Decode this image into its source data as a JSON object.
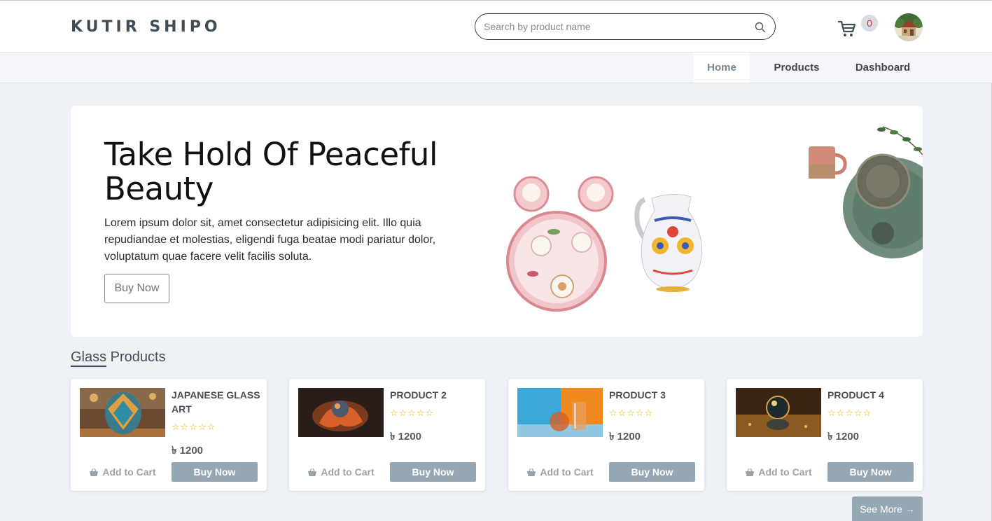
{
  "header": {
    "brand": "KUTIR SHIPO",
    "search_placeholder": "Search by product name",
    "cart_count": "0"
  },
  "nav": {
    "items": [
      {
        "label": "Home"
      },
      {
        "label": "Products"
      },
      {
        "label": "Dashboard"
      }
    ]
  },
  "hero": {
    "title": "Take Hold Of Peaceful Beauty",
    "text": "Lorem ipsum dolor sit, amet consectetur adipisicing elit. Illo quia repudiandae et molestias, eligendi fuga beatae modi pariatur dolor, voluptatum quae facere velit facilis soluta.",
    "button": "Buy Now"
  },
  "section": {
    "title_first": "Glass",
    "title_rest": " Products"
  },
  "products": [
    {
      "name": "JAPANESE GLASS ART",
      "stars": "☆☆☆☆☆",
      "price": "৳ 1200",
      "add": "Add to Cart",
      "buy": "Buy Now"
    },
    {
      "name": "PRODUCT 2",
      "stars": "☆☆☆☆☆",
      "price": "৳ 1200",
      "add": "Add to Cart",
      "buy": "Buy Now"
    },
    {
      "name": "PRODUCT 3",
      "stars": "☆☆☆☆☆",
      "price": "৳ 1200",
      "add": "Add to Cart",
      "buy": "Buy Now"
    },
    {
      "name": "PRODUCT 4",
      "stars": "☆☆☆☆☆",
      "price": "৳ 1200",
      "add": "Add to Cart",
      "buy": "Buy Now"
    }
  ],
  "see_more": "See More →",
  "colors": {
    "accent": "#94a7b3",
    "background": "#eef2f6",
    "brand": "#3f4b55",
    "star": "#e0b100"
  }
}
